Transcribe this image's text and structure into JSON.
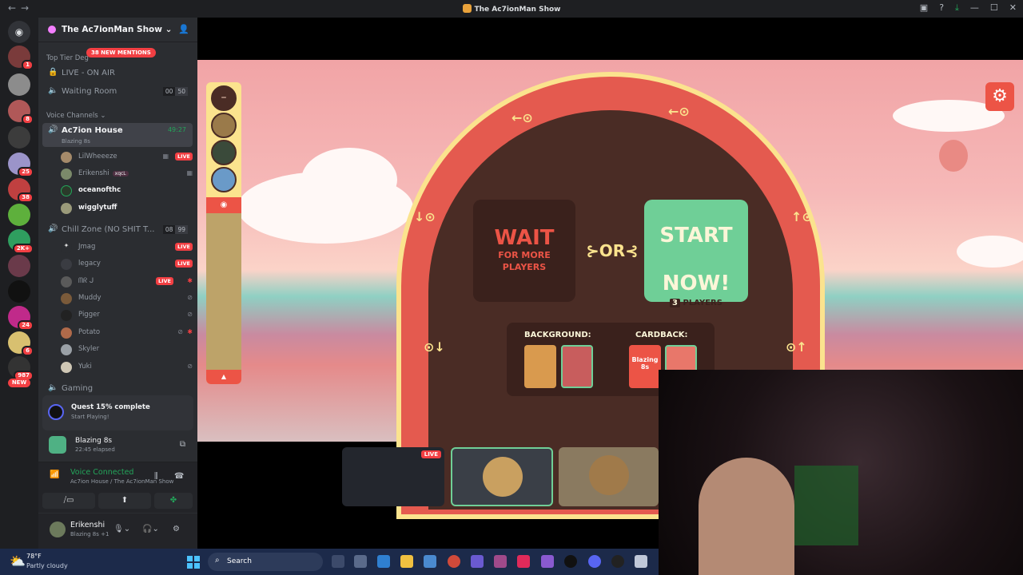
{
  "window": {
    "title": "The Ac7ionMan Show"
  },
  "server": {
    "name": "The Ac7ionMan Show",
    "mentions_pill": "38 NEW MENTIONS",
    "category_top": "Top Tier Deg",
    "channels": [
      {
        "label": "LIVE - ON AIR"
      },
      {
        "label": "Waiting Room",
        "count_a": "00",
        "count_b": "50"
      }
    ],
    "voice_category": "Voice Channels",
    "active_channel": {
      "label": "Ac7ion House",
      "activity": "Blazing 8s",
      "timer": "49:27"
    },
    "members_a": [
      {
        "name": "LilWheeeze",
        "live": "LIVE"
      },
      {
        "name": "Erikenshi",
        "tag": "xqcL"
      },
      {
        "name": "oceanofthc"
      },
      {
        "name": "wigglytuff"
      }
    ],
    "channel_chill": {
      "label": "Chill Zone (NO SHIT T...",
      "count_a": "08",
      "count_b": "99"
    },
    "members_b": [
      {
        "name": "Jmag",
        "live": "LIVE"
      },
      {
        "name": "legacy",
        "live": "LIVE"
      },
      {
        "name": "ᗰᖇ ᒍ",
        "live": "LIVE"
      },
      {
        "name": "Muddy"
      },
      {
        "name": "Pigger"
      },
      {
        "name": "Potato"
      },
      {
        "name": "Skyler"
      },
      {
        "name": "Yuki"
      }
    ],
    "channel_gaming": "Gaming"
  },
  "rail": {
    "badges": [
      "1",
      "8",
      "25",
      "38",
      "2K+",
      "24",
      "6",
      "987"
    ],
    "new_label": "NEW"
  },
  "quest": {
    "title": "Quest 15% complete",
    "subtitle": "Start Playing!"
  },
  "activity": {
    "name": "Blazing 8s",
    "elapsed": "22:45 elapsed"
  },
  "voice": {
    "status": "Voice Connected",
    "location": "Ac7ion House / The Ac7ionMan Show"
  },
  "user": {
    "name": "Erikenshi",
    "status": "Blazing 8s +1"
  },
  "game": {
    "wait_big": "WAIT",
    "wait_small_1": "FOR MORE",
    "wait_small_2": "PLAYERS",
    "or": "OR",
    "start_1": "START",
    "start_2": "NOW!",
    "players_count": "3",
    "players_label": "PLAYERS",
    "background_label": "BACKGROUND:",
    "cardback_label": "CARDBACK:",
    "cardback_text": "Blazing 8s"
  },
  "streams": {
    "live_label": "LIVE"
  },
  "taskbar": {
    "temp": "78°F",
    "condition": "Partly cloudy",
    "search": "Search"
  },
  "colors": {
    "discord_bg": "#2b2d31",
    "accent_red": "#ec5446",
    "online_green": "#23a55a",
    "arch_yellow": "#fbe38e"
  }
}
